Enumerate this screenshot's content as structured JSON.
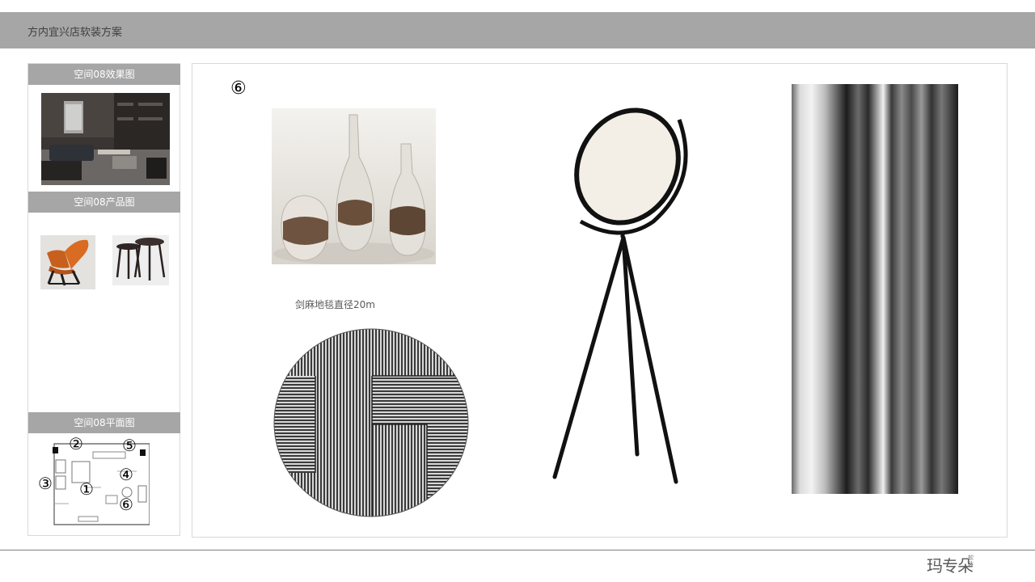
{
  "header": {
    "title": "方内宜兴店软装方案"
  },
  "sidebar": {
    "render_title": "空间08效果图",
    "products_title": "空间08产品图",
    "plan_title": "空间08平面图",
    "plan_markers": [
      "②",
      "⑤",
      "③",
      "④",
      "①",
      "⑥"
    ]
  },
  "main": {
    "number": "⑥",
    "rug_label": "剑麻地毯直径20m"
  },
  "footer": {
    "logo_text": "玛专朵",
    "logo_sub": "软装"
  }
}
